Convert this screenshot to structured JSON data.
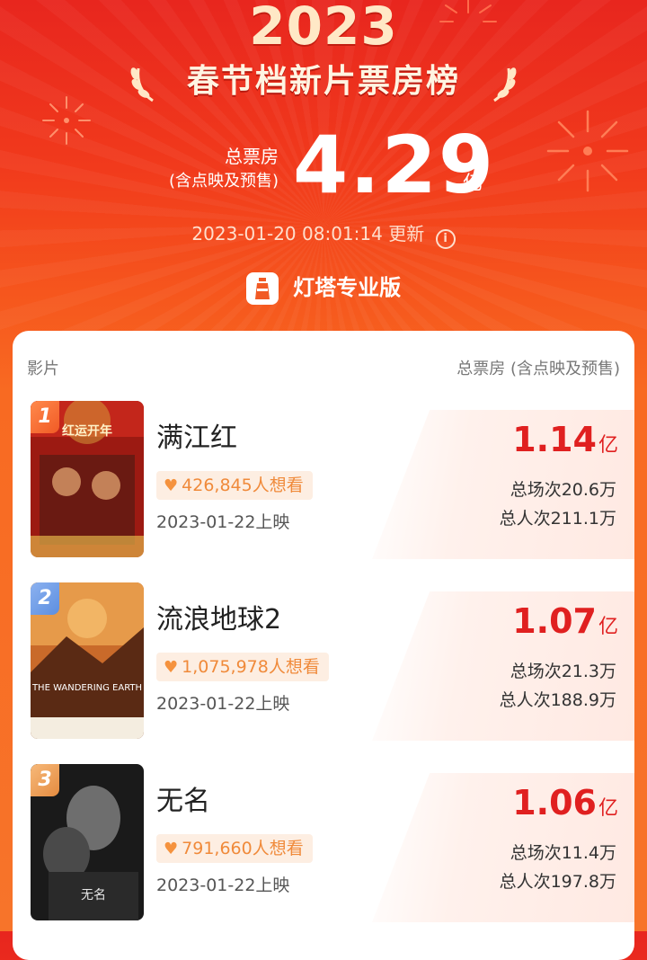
{
  "header": {
    "year": "2023",
    "title": "春节档新片票房榜",
    "total_label": "总票房",
    "total_sub": "(含点映及预售)",
    "total_value": "4.29",
    "total_unit": "亿",
    "update_time": "2023-01-20 08:01:14",
    "update_label": "更新",
    "brand": "灯塔专业版"
  },
  "table": {
    "col_left": "影片",
    "col_right": "总票房 (含点映及预售)"
  },
  "movies": [
    {
      "rank": "1",
      "name": "满江红",
      "want": "426,845人想看",
      "release": "2023-01-22上映",
      "gross": "1.14",
      "gross_unit": "亿",
      "shows": "总场次20.6万",
      "attendance": "总人次211.1万",
      "poster_text": "红运开年"
    },
    {
      "rank": "2",
      "name": "流浪地球2",
      "want": "1,075,978人想看",
      "release": "2023-01-22上映",
      "gross": "1.07",
      "gross_unit": "亿",
      "shows": "总场次21.3万",
      "attendance": "总人次188.9万",
      "poster_text": "THE WANDERING EARTH"
    },
    {
      "rank": "3",
      "name": "无名",
      "want": "791,660人想看",
      "release": "2023-01-22上映",
      "gross": "1.06",
      "gross_unit": "亿",
      "shows": "总场次11.4万",
      "attendance": "总人次197.8万",
      "poster_text": "无名"
    }
  ],
  "colors": {
    "brand_red": "#e8261e",
    "orange": "#f7742a",
    "gross_red": "#e02020",
    "want_orange": "#f08a3a"
  }
}
